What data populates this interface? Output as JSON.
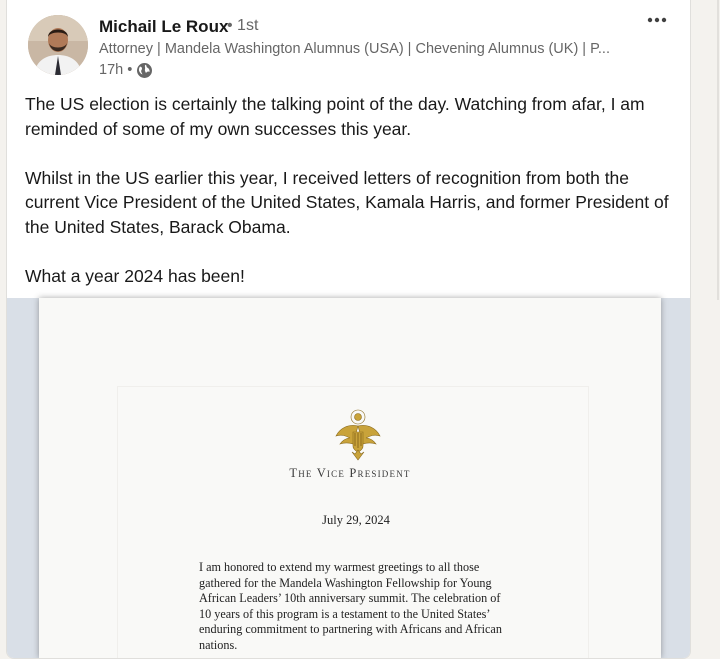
{
  "post": {
    "author_name": "Michail Le Roux",
    "connection_degree": "• 1st",
    "headline": "Attorney | Mandela Washington Alumnus (USA) | Chevening Alumnus (UK) | P...",
    "time_ago": "17h •",
    "visibility_icon": "globe-icon",
    "more_icon": "more-options-icon",
    "paragraphs": [
      "The US election is certainly the talking point of the day. Watching from afar, I am reminded of some of my own successes this year.",
      "Whilst in the US earlier this year, I received letters of recognition from both the current Vice President of the United States, Kamala Harris, and former President of the United States, Barack Obama.",
      "What a year 2024 has been!"
    ]
  },
  "letter": {
    "header": "The Vice President",
    "date": "July 29, 2024",
    "body_lines": [
      "I am honored to extend my warmest greetings to all those",
      "gathered for the Mandela Washington Fellowship for Young",
      "African Leaders’ 10th anniversary summit.  The celebration of",
      "10 years of this program is a testament to the United States’",
      "enduring commitment to partnering with Africans and African",
      "nations."
    ]
  },
  "colors": {
    "text_primary": "#191919",
    "text_secondary": "#666666",
    "seal_gold": "#c9a33a"
  }
}
